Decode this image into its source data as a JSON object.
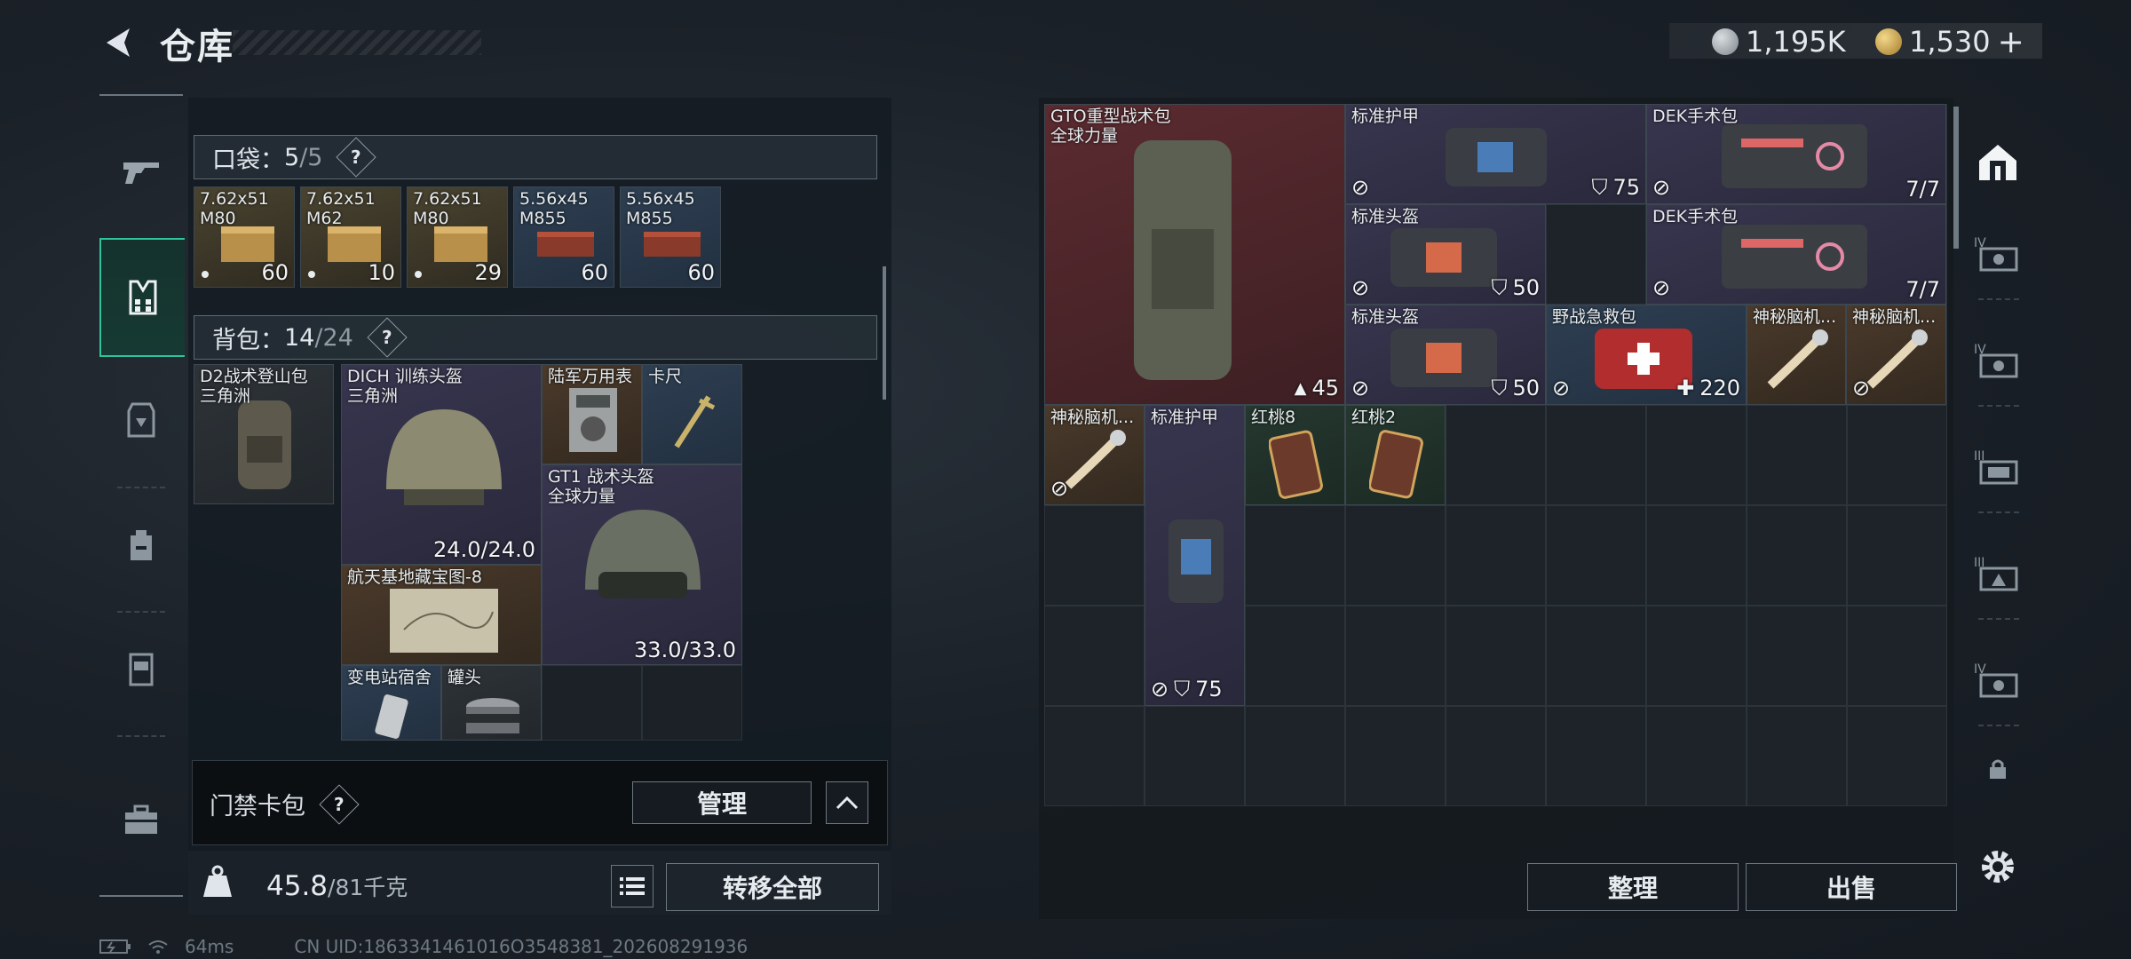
{
  "header": {
    "title": "仓库",
    "currency_silver": "1,195K",
    "currency_gold": "1,530",
    "add_symbol": "+"
  },
  "left_nav": {
    "items": [
      "gun-icon",
      "chest-rig-icon",
      "armor-vest-icon",
      "backpack-icon",
      "pouch-icon",
      "toolbox-icon"
    ],
    "active": "chest-rig-icon"
  },
  "pocket": {
    "label": "口袋：",
    "used": "5",
    "capacity": "/5",
    "help": "?",
    "items": [
      {
        "name": "7.62x51\nM80",
        "count": "60",
        "rarity": "gold"
      },
      {
        "name": "7.62x51\nM62",
        "count": "10",
        "rarity": "gold"
      },
      {
        "name": "7.62x51\nM80",
        "count": "29",
        "rarity": "gold"
      },
      {
        "name": "5.56x45\nM855",
        "count": "60",
        "rarity": "blue"
      },
      {
        "name": "5.56x45\nM855",
        "count": "60",
        "rarity": "blue"
      }
    ]
  },
  "backpack": {
    "label": "背包：",
    "used": "14",
    "capacity": "/24",
    "help": "?",
    "items": {
      "d2": {
        "name": "D2战术登山包\n三角洲"
      },
      "dich": {
        "name": "DICH 训练头盔\n三角洲",
        "durability": "24.0/24.0"
      },
      "watch": {
        "name": "陆军万用表"
      },
      "caliper": {
        "name": "卡尺"
      },
      "gt1": {
        "name": "GT1 战术头盔\n全球力量",
        "durability": "33.0/33.0"
      },
      "map": {
        "name": "航天基地藏宝图-8"
      },
      "dorm": {
        "name": "变电站宿舍"
      },
      "can": {
        "name": "罐头"
      }
    }
  },
  "keycard": {
    "label": "门禁卡包",
    "help": "?",
    "manage": "管理"
  },
  "weight": {
    "current": "45.8",
    "max": "/81千克",
    "kg_label": "KG",
    "transfer_all": "转移全部"
  },
  "stash": {
    "items": {
      "gto": {
        "name": "GTO重型战术包\n全球力量",
        "capacity": "45"
      },
      "armor1": {
        "name": "标准护甲",
        "armor": "75"
      },
      "dek1": {
        "name": "DEK手术包",
        "uses": "7/7"
      },
      "helm1": {
        "name": "标准头盔",
        "armor": "50"
      },
      "dek2": {
        "name": "DEK手术包",
        "uses": "7/7"
      },
      "helm2": {
        "name": "标准头盔",
        "armor": "50"
      },
      "medkit": {
        "name": "野战急救包",
        "heal": "220"
      },
      "brain1": {
        "name": "神秘脑机..."
      },
      "brain2": {
        "name": "神秘脑机..."
      },
      "brain3": {
        "name": "神秘脑机..."
      },
      "armor2": {
        "name": "标准护甲",
        "armor": "75"
      },
      "peach8": {
        "name": "红桃8"
      },
      "peach2": {
        "name": "红桃2"
      }
    },
    "sort": "整理",
    "sell": "出售"
  },
  "right_nav": {
    "tabs": [
      "IV",
      "IV",
      "III",
      "III",
      "IV"
    ]
  },
  "footer": {
    "ping": "64ms",
    "uid": "CN UID:1863341461016O3548381_202608291936"
  },
  "colors": {
    "accent_green": "#2ec39b",
    "gold_bg": "#4a4330",
    "blue_bg": "#2e3f52",
    "red_bg": "#5b2b30"
  }
}
